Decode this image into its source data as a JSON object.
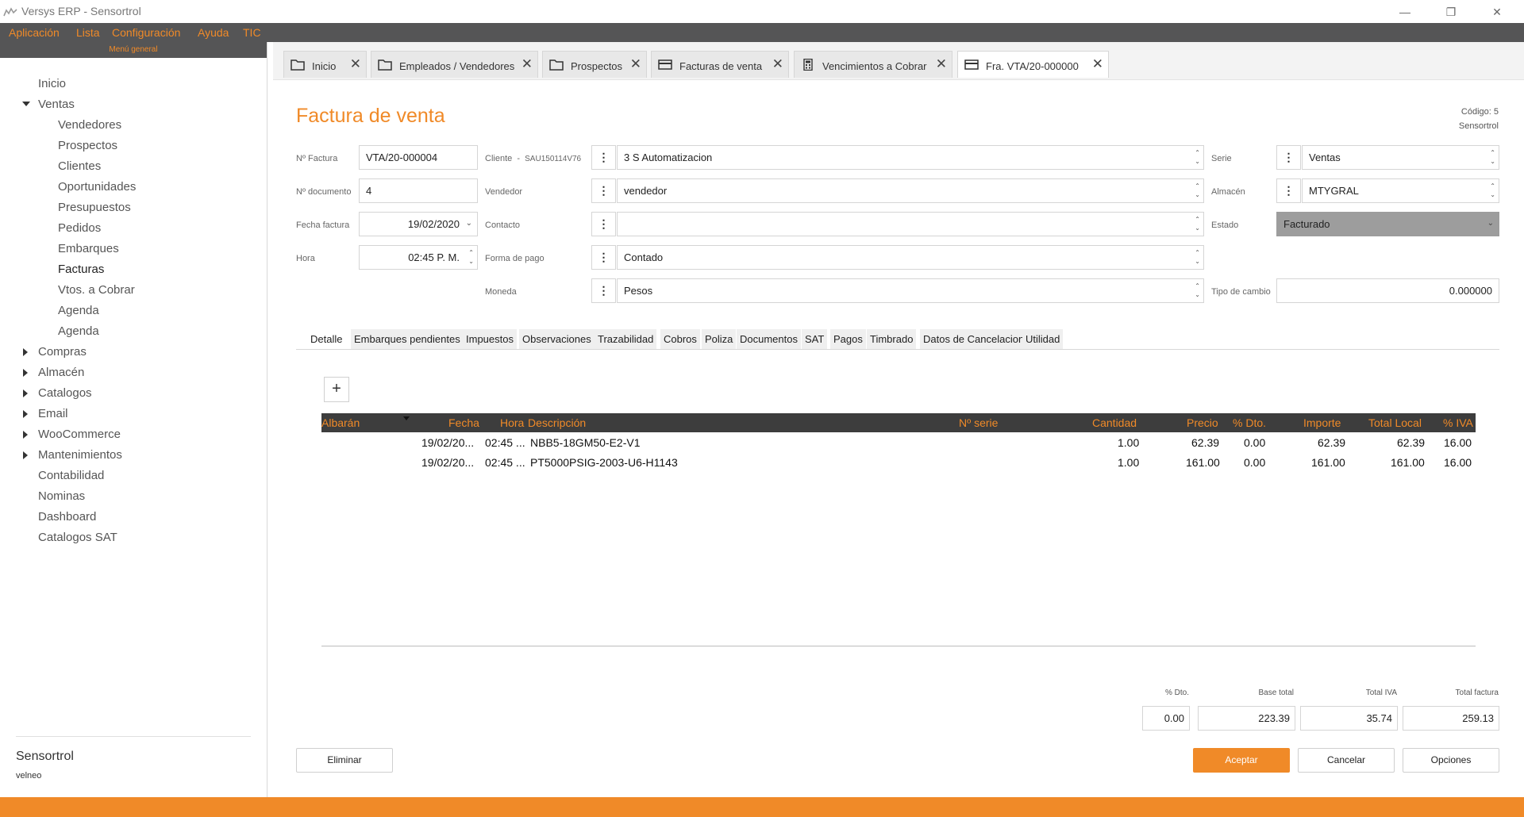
{
  "window": {
    "title": "Versys ERP - Sensortrol"
  },
  "menubar": {
    "items": [
      "Aplicación",
      "Lista",
      "Configuración",
      "Ayuda",
      "TIC"
    ]
  },
  "sidebar": {
    "header": "Menú general",
    "items": [
      "Inicio",
      "Ventas",
      "Vendedores",
      "Prospectos",
      "Clientes",
      "Oportunidades",
      "Presupuestos",
      "Pedidos",
      "Embarques",
      "Facturas",
      "Vtos. a Cobrar",
      "Agenda",
      "Agenda",
      "Compras",
      "Almacén",
      "Catalogos",
      "Email",
      "WooCommerce",
      "Mantenimientos",
      "Contabilidad",
      "Nominas",
      "Dashboard",
      "Catalogos SAT"
    ],
    "company": "Sensortrol",
    "company_sub": "velneo"
  },
  "tabs": [
    "Inicio",
    "Empleados / Vendedores",
    "Prospectos",
    "Facturas de venta",
    "Vencimientos a Cobrar",
    "Fra. VTA/20-000000"
  ],
  "form": {
    "title": "Factura de venta",
    "code_label": "Código: 5",
    "code_company": "Sensortrol",
    "labels": {
      "num_factura": "Nº Factura",
      "num_documento": "Nº documento",
      "fecha_factura": "Fecha factura",
      "hora": "Hora",
      "cliente": "Cliente",
      "cliente_rfc": "SAU150114V76",
      "vendedor": "Vendedor",
      "contacto": "Contacto",
      "forma_pago": "Forma de pago",
      "moneda": "Moneda",
      "serie": "Serie",
      "almacen": "Almacén",
      "estado": "Estado",
      "tipo_cambio": "Tipo de cambio"
    },
    "values": {
      "num_factura": "VTA/20-000004",
      "num_documento": "4",
      "fecha_factura": "19/02/2020",
      "hora": "02:45 P. M.",
      "cliente": "3 S Automatizacion",
      "vendedor": "vendedor",
      "contacto": "",
      "forma_pago": "Contado",
      "moneda": "Pesos",
      "serie": "Ventas",
      "almacen": "MTYGRAL",
      "estado": "Facturado",
      "tipo_cambio": "0.000000"
    }
  },
  "subtabs": [
    "Detalle",
    "Embarques pendientes",
    "Impuestos",
    "Observaciones",
    "Trazabilidad",
    "Cobros",
    "Poliza",
    "Documentos",
    "SAT",
    "Pagos",
    "Timbrado",
    "Datos de Cancelacion",
    "Utilidad"
  ],
  "grid": {
    "add_label": "+",
    "columns": [
      "Albarán",
      "Fecha",
      "Hora",
      "Descripción",
      "Nº serie",
      "Cantidad",
      "Precio",
      "% Dto.",
      "Importe",
      "Total Local",
      "% IVA"
    ],
    "rows": [
      {
        "fecha": "19/02/20...",
        "hora": "02:45 ...",
        "descripcion": "NBB5-18GM50-E2-V1",
        "serie": "",
        "cantidad": "1.00",
        "precio": "62.39",
        "dto": "0.00",
        "importe": "62.39",
        "total_local": "62.39",
        "iva": "16.00"
      },
      {
        "fecha": "19/02/20...",
        "hora": "02:45 ...",
        "descripcion": "PT5000PSIG-2003-U6-H1143",
        "serie": "",
        "cantidad": "1.00",
        "precio": "161.00",
        "dto": "0.00",
        "importe": "161.00",
        "total_local": "161.00",
        "iva": "16.00"
      }
    ]
  },
  "totals": {
    "labels": [
      "% Dto.",
      "Base total",
      "Total IVA",
      "Total factura"
    ],
    "values": [
      "0.00",
      "223.39",
      "35.74",
      "259.13"
    ]
  },
  "buttons": {
    "eliminar": "Eliminar",
    "aceptar": "Aceptar",
    "cancelar": "Cancelar",
    "opciones": "Opciones"
  },
  "colors": {
    "accent": "#f08a28",
    "dark_bar": "#555556",
    "grid_header": "#3d3d3d"
  }
}
